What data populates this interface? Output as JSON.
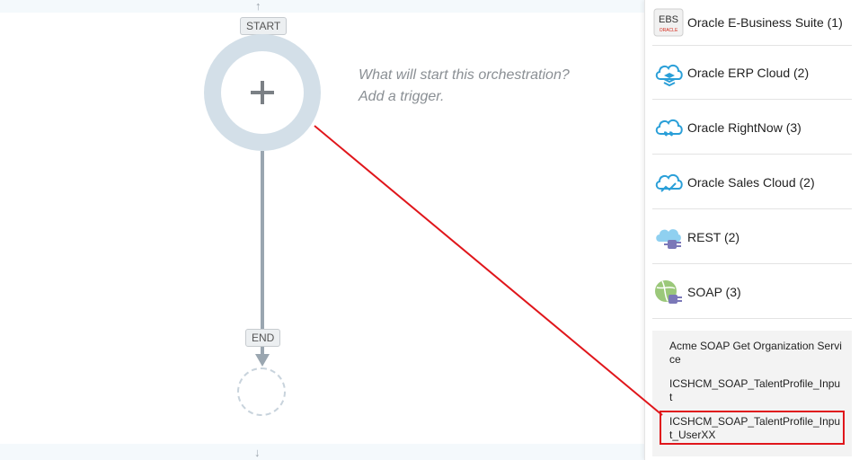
{
  "canvas": {
    "start_badge": "START",
    "end_badge": "END",
    "prompt_line1": "What will start this orchestration?",
    "prompt_line2": "Add a trigger.",
    "up_arrow": "↑",
    "down_arrow": "↓"
  },
  "panel": {
    "adapters": [
      {
        "label": "Oracle E-Business Suite (1)",
        "icon": "ebs-icon",
        "icon_text": "EBS",
        "icon_subtext": "ORACLE"
      },
      {
        "label": "Oracle ERP Cloud (2)",
        "icon": "erp-cloud-icon"
      },
      {
        "label": "Oracle RightNow (3)",
        "icon": "rightnow-cloud-icon"
      },
      {
        "label": "Oracle Sales Cloud (2)",
        "icon": "sales-cloud-icon"
      },
      {
        "label": "REST (2)",
        "icon": "rest-plug-icon"
      },
      {
        "label": "SOAP (3)",
        "icon": "soap-globe-icon"
      }
    ],
    "soap_connections": [
      {
        "label": "Acme SOAP Get Organization Service"
      },
      {
        "label": "ICSHCM_SOAP_TalentProfile_Input"
      },
      {
        "label": "ICSHCM_SOAP_TalentProfile_Input_UserXX"
      }
    ]
  },
  "colors": {
    "highlight": "#e0161b",
    "cloud_blue": "#2a9fd8",
    "ring": "#d3dfe8"
  }
}
